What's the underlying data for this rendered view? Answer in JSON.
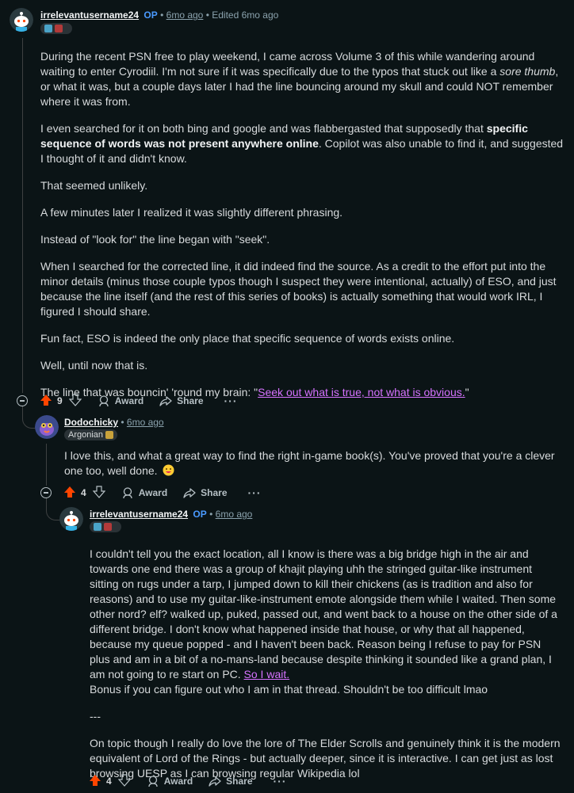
{
  "comment1": {
    "username": "irrelevantusername24",
    "op": "OP",
    "sep1": "•",
    "time": "6mo ago",
    "sep2": "•",
    "edited": "Edited 6mo ago",
    "paragraphs": {
      "p1": "During the recent PSN free to play weekend, I came across Volume 3 of this while wandering around waiting to enter Cyrodiil. I'm not sure if it was specifically due to the typos that stuck out like a",
      "p1_em": "sore thumb",
      "p1_end": ", or what it was, but a couple days later I had the line bouncing around my skull and could NOT remember where it was from.",
      "p2": "I even searched for it on both bing and google and was flabbergasted that supposedly that",
      "p2_strong": "specific sequence of words was not present anywhere online",
      "p2_end": ". Copilot was also unable to find it, and suggested I thought of it and didn't know.",
      "p3": "That seemed unlikely.",
      "p4": "A few minutes later I realized it was slightly different phrasing.",
      "p5": "Instead of \"look for\" the line began with \"seek\".",
      "p6": "When I searched for the corrected line, it did indeed find the source. As a credit to the effort put into the minor details (minus those couple typos though I suspect they were intentional, actually) of ESO, and just because the line itself (and the rest of this series of books) is actually something that would work IRL, I figured I should share.",
      "p7": "Fun fact, ESO is indeed the only place that specific sequence of words exists online.",
      "p8": "Well, until now that is.",
      "p9": "The line that was bouncin' 'round my brain: \"",
      "p9_link": "Seek out what is true, not what is obvious.",
      "p9_end": "\""
    },
    "votes": "9",
    "award": "Award",
    "share": "Share",
    "more": "···"
  },
  "comment2": {
    "username": "Dodochicky",
    "sep1": "•",
    "time": "6mo ago",
    "flair": "Argonian",
    "text": "I love this, and what a great way to find the right in-game book(s). You've proved that you're a clever one too, well done.",
    "votes": "4",
    "award": "Award",
    "share": "Share",
    "more": "···"
  },
  "comment3": {
    "username": "irrelevantusername24",
    "op": "OP",
    "sep1": "•",
    "time": "6mo ago",
    "p1": "I couldn't tell you the exact location, all I know is there was a big bridge high in the air and towards one end there was a group of khajit playing uhh the stringed guitar-like instrument sitting on rugs under a tarp, I jumped down to kill their chickens (as is tradition and also for reasons) and to use my guitar-like-instrument emote alongside them while I waited. Then some other nord? elf? walked up, puked, passed out, and went back to a house on the other side of a different bridge. I don't know what happened inside that house, or why that all happened, because my queue popped - and I haven't been back. Reason being I refuse to pay for PSN plus and am in a bit of a no-mans-land because despite thinking it sounded like a grand plan, I am not going to re start on PC.",
    "p1_link": "So I wait.",
    "p1_end": "Bonus if you can figure out who I am in that thread. Shouldn't be too difficult lmao",
    "divider": "---",
    "p2": "On topic though I really do love the lore of The Elder Scrolls and genuinely think it is the modern equivalent of Lord of the Rings - but actually deeper, since it is interactive. I can get just as lost browsing UESP as I can browsing regular Wikipedia lol",
    "votes": "4",
    "award": "Award",
    "share": "Share",
    "more": "···"
  },
  "colors": {
    "upvote": "#ff4500",
    "link": "#d672ff",
    "op": "#4a9aff",
    "background": "#0b1416"
  },
  "icons": [
    "snoo-avatar",
    "dodo-avatar",
    "upvote-icon",
    "downvote-icon",
    "award-icon",
    "share-icon",
    "collapse-icon",
    "emoji-icon"
  ]
}
